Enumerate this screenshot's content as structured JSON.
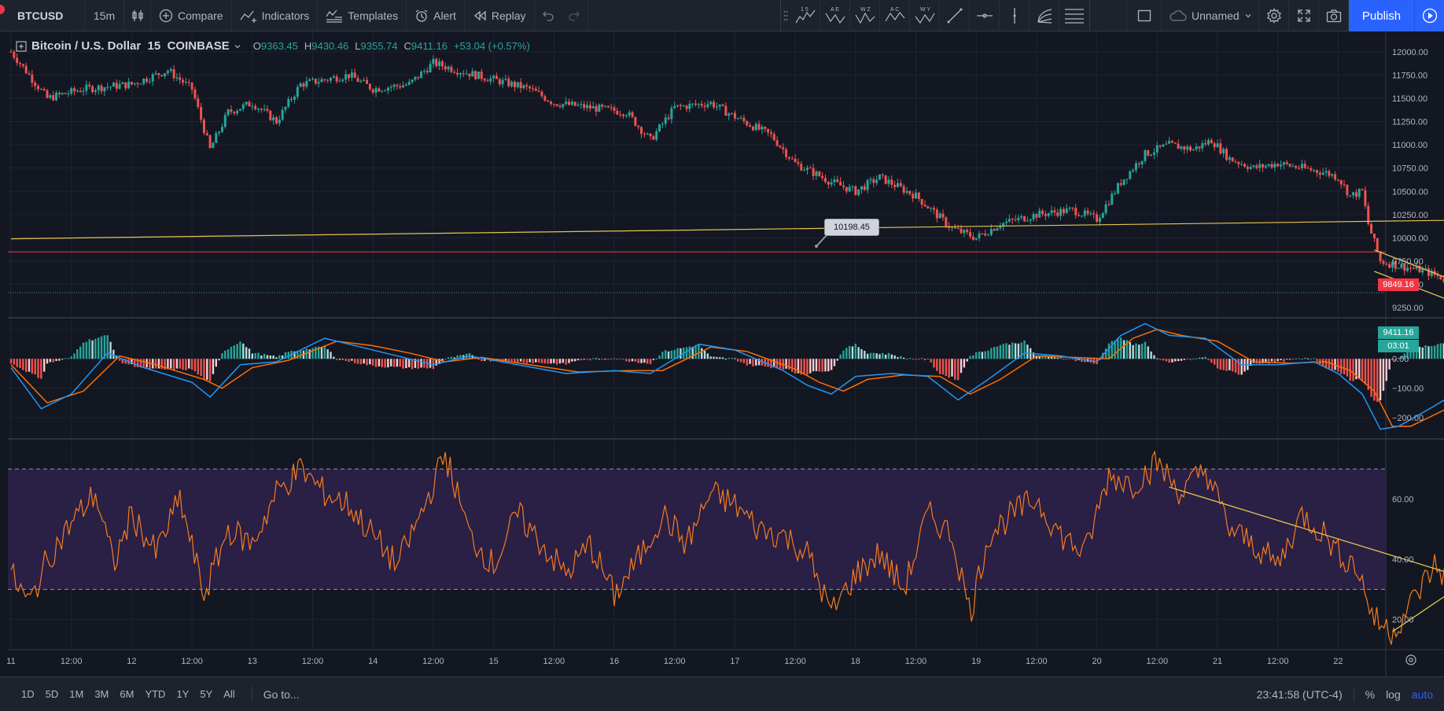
{
  "toolbar": {
    "symbol": "BTCUSD",
    "interval": "15m",
    "compare": "Compare",
    "indicators": "Indicators",
    "templates": "Templates",
    "alert": "Alert",
    "replay": "Replay",
    "layout_name": "Unnamed",
    "publish": "Publish",
    "pattern_tools": [
      {
        "top": "1 5",
        "icon": "pattern-icon"
      },
      {
        "top": "A E",
        "icon": "pattern-icon"
      },
      {
        "top": "W Z",
        "icon": "pattern-icon"
      },
      {
        "top": "A C",
        "icon": "pattern-icon"
      },
      {
        "top": "W Y",
        "icon": "pattern-icon"
      }
    ]
  },
  "legend": {
    "title": "Bitcoin / U.S. Dollar",
    "interval": "15",
    "exchange": "COINBASE",
    "o_label": "O",
    "o": "9363.45",
    "h_label": "H",
    "h": "9430.46",
    "l_label": "L",
    "l": "9355.74",
    "c_label": "C",
    "c": "9411.16",
    "change": "+53.04 (+0.57%)"
  },
  "price_axis": {
    "ticks": [
      "12000.00",
      "11750.00",
      "11500.00",
      "11250.00",
      "11000.00",
      "10750.00",
      "10500.00",
      "10250.00",
      "10000.00",
      "9750.00",
      "9500.00"
    ],
    "red_line_label": "9849.16",
    "last_price_label": "9411.16",
    "countdown": "03:01",
    "hidden_tick": "9250.00"
  },
  "macd_axis": {
    "ticks": [
      "100.00",
      "0.00",
      "−100.00",
      "−200.00"
    ]
  },
  "rsi_axis": {
    "ticks": [
      "60.00",
      "40.00",
      "20.00"
    ]
  },
  "time_axis": {
    "labels": [
      "11",
      "12:00",
      "12",
      "12:00",
      "13",
      "12:00",
      "14",
      "12:00",
      "15",
      "12:00",
      "16",
      "12:00",
      "17",
      "12:00",
      "18",
      "12:00",
      "19",
      "12:00",
      "20",
      "12:00",
      "21",
      "12:00",
      "22"
    ]
  },
  "trendline_tooltip": "10198.45",
  "bottom": {
    "ranges": [
      "1D",
      "5D",
      "1M",
      "3M",
      "6M",
      "YTD",
      "1Y",
      "5Y",
      "All"
    ],
    "goto": "Go to...",
    "clock": "23:41:58 (UTC-4)",
    "percent": "%",
    "log": "log",
    "auto": "auto"
  },
  "colors": {
    "bg": "#131722",
    "up": "#26a69a",
    "down": "#ef5350",
    "trend": "#e5c54f",
    "red_line": "#f23645",
    "macd": "#2196f3",
    "signal": "#ff6d00",
    "rsi": "#f57c1f",
    "rsi_band": "#2a1f45",
    "accent": "#2962ff"
  },
  "chart_data": {
    "type": "candlestick",
    "symbol": "BTCUSD",
    "interval": "15",
    "ylim": [
      9150,
      12150
    ],
    "close_path": [
      [
        0,
        12000
      ],
      [
        0.3,
        11500
      ],
      [
        0.6,
        11600
      ],
      [
        1.0,
        11650
      ],
      [
        1.3,
        11800
      ],
      [
        1.5,
        11600
      ],
      [
        1.65,
        10950
      ],
      [
        1.8,
        11350
      ],
      [
        2.0,
        11450
      ],
      [
        2.2,
        11250
      ],
      [
        2.4,
        11650
      ],
      [
        2.6,
        11700
      ],
      [
        2.8,
        11750
      ],
      [
        3.0,
        11600
      ],
      [
        3.3,
        11650
      ],
      [
        3.5,
        11880
      ],
      [
        3.7,
        11800
      ],
      [
        4.0,
        11700
      ],
      [
        4.3,
        11600
      ],
      [
        4.5,
        11450
      ],
      [
        4.8,
        11400
      ],
      [
        5.1,
        11350
      ],
      [
        5.3,
        11050
      ],
      [
        5.5,
        11400
      ],
      [
        5.8,
        11450
      ],
      [
        6.0,
        11300
      ],
      [
        6.3,
        11100
      ],
      [
        6.5,
        10800
      ],
      [
        6.8,
        10600
      ],
      [
        7.0,
        10500
      ],
      [
        7.2,
        10650
      ],
      [
        7.5,
        10450
      ],
      [
        7.8,
        10100
      ],
      [
        8.0,
        10000
      ],
      [
        8.2,
        10150
      ],
      [
        8.5,
        10250
      ],
      [
        8.8,
        10300
      ],
      [
        9.0,
        10200
      ],
      [
        9.2,
        10600
      ],
      [
        9.4,
        10900
      ],
      [
        9.6,
        11000
      ],
      [
        9.8,
        10950
      ],
      [
        9.95,
        11050
      ],
      [
        10.1,
        10850
      ],
      [
        10.3,
        10750
      ],
      [
        10.5,
        10800
      ],
      [
        10.7,
        10750
      ],
      [
        10.9,
        10700
      ],
      [
        11.0,
        10650
      ],
      [
        11.1,
        10450
      ],
      [
        11.2,
        10500
      ],
      [
        11.25,
        10150
      ],
      [
        11.3,
        9950
      ],
      [
        11.35,
        9750
      ],
      [
        11.5,
        9700
      ],
      [
        11.7,
        9650
      ],
      [
        11.9,
        9550
      ],
      [
        12.0,
        9520
      ],
      [
        12.1,
        9420
      ],
      [
        12.2,
        9411
      ]
    ],
    "trendline": {
      "x": [
        0,
        22.8
      ],
      "y": [
        9990,
        10370
      ]
    },
    "horizontal_level": 9849.16,
    "last_price": 9411.16,
    "channel": {
      "upper": [
        [
          11.3,
          9870
        ],
        [
          12.1,
          9470
        ]
      ],
      "lower": [
        [
          11.3,
          9640
        ],
        [
          12.1,
          9240
        ]
      ]
    },
    "macd": {
      "ylim": [
        -270,
        140
      ],
      "macd_line": [
        [
          0,
          -30
        ],
        [
          0.25,
          -170
        ],
        [
          0.5,
          -120
        ],
        [
          0.8,
          20
        ],
        [
          1.1,
          -30
        ],
        [
          1.5,
          -80
        ],
        [
          1.65,
          -130
        ],
        [
          1.9,
          -20
        ],
        [
          2.2,
          -10
        ],
        [
          2.6,
          70
        ],
        [
          2.9,
          40
        ],
        [
          3.1,
          20
        ],
        [
          3.5,
          -20
        ],
        [
          3.8,
          10
        ],
        [
          4.2,
          -20
        ],
        [
          4.6,
          -50
        ],
        [
          5.0,
          -40
        ],
        [
          5.3,
          -50
        ],
        [
          5.7,
          50
        ],
        [
          6.0,
          30
        ],
        [
          6.4,
          -40
        ],
        [
          6.6,
          -90
        ],
        [
          6.8,
          -120
        ],
        [
          7.0,
          -60
        ],
        [
          7.3,
          -50
        ],
        [
          7.6,
          -60
        ],
        [
          7.85,
          -140
        ],
        [
          8.1,
          -70
        ],
        [
          8.4,
          20
        ],
        [
          8.7,
          10
        ],
        [
          9.0,
          -10
        ],
        [
          9.2,
          80
        ],
        [
          9.4,
          120
        ],
        [
          9.6,
          80
        ],
        [
          9.9,
          70
        ],
        [
          10.2,
          -20
        ],
        [
          10.5,
          -20
        ],
        [
          10.8,
          -10
        ],
        [
          11.0,
          -50
        ],
        [
          11.2,
          -120
        ],
        [
          11.35,
          -240
        ],
        [
          11.5,
          -230
        ],
        [
          11.8,
          -160
        ],
        [
          12.0,
          -110
        ],
        [
          12.2,
          -90
        ]
      ],
      "signal_line": [
        [
          0,
          -20
        ],
        [
          0.3,
          -150
        ],
        [
          0.6,
          -110
        ],
        [
          0.9,
          10
        ],
        [
          1.2,
          -20
        ],
        [
          1.6,
          -70
        ],
        [
          1.75,
          -100
        ],
        [
          2.0,
          -30
        ],
        [
          2.3,
          -5
        ],
        [
          2.7,
          60
        ],
        [
          3.0,
          45
        ],
        [
          3.3,
          20
        ],
        [
          3.6,
          -10
        ],
        [
          3.9,
          5
        ],
        [
          4.3,
          -20
        ],
        [
          4.7,
          -45
        ],
        [
          5.1,
          -40
        ],
        [
          5.4,
          -40
        ],
        [
          5.8,
          40
        ],
        [
          6.1,
          25
        ],
        [
          6.5,
          -35
        ],
        [
          6.7,
          -80
        ],
        [
          6.9,
          -110
        ],
        [
          7.1,
          -70
        ],
        [
          7.4,
          -55
        ],
        [
          7.7,
          -60
        ],
        [
          7.95,
          -120
        ],
        [
          8.2,
          -70
        ],
        [
          8.5,
          10
        ],
        [
          8.8,
          5
        ],
        [
          9.1,
          0
        ],
        [
          9.3,
          70
        ],
        [
          9.5,
          100
        ],
        [
          9.7,
          80
        ],
        [
          10.0,
          60
        ],
        [
          10.3,
          -10
        ],
        [
          10.6,
          -15
        ],
        [
          10.9,
          -10
        ],
        [
          11.1,
          -40
        ],
        [
          11.3,
          -110
        ],
        [
          11.45,
          -230
        ],
        [
          11.6,
          -230
        ],
        [
          11.9,
          -170
        ],
        [
          12.1,
          -120
        ],
        [
          12.2,
          -100
        ]
      ]
    },
    "rsi": {
      "ylim": [
        10,
        80
      ],
      "overbought": 70,
      "oversold": 30,
      "series": [
        [
          0,
          35
        ],
        [
          0.15,
          25
        ],
        [
          0.3,
          40
        ],
        [
          0.5,
          52
        ],
        [
          0.7,
          62
        ],
        [
          0.85,
          38
        ],
        [
          1.0,
          55
        ],
        [
          1.2,
          42
        ],
        [
          1.4,
          60
        ],
        [
          1.6,
          28
        ],
        [
          1.8,
          50
        ],
        [
          2.0,
          45
        ],
        [
          2.2,
          62
        ],
        [
          2.4,
          70
        ],
        [
          2.6,
          62
        ],
        [
          2.8,
          58
        ],
        [
          3.0,
          48
        ],
        [
          3.2,
          38
        ],
        [
          3.4,
          55
        ],
        [
          3.6,
          75
        ],
        [
          3.8,
          48
        ],
        [
          4.0,
          38
        ],
        [
          4.2,
          55
        ],
        [
          4.4,
          45
        ],
        [
          4.6,
          35
        ],
        [
          4.8,
          45
        ],
        [
          5.0,
          28
        ],
        [
          5.2,
          40
        ],
        [
          5.4,
          55
        ],
        [
          5.6,
          45
        ],
        [
          5.8,
          62
        ],
        [
          6.0,
          58
        ],
        [
          6.2,
          50
        ],
        [
          6.4,
          48
        ],
        [
          6.6,
          42
        ],
        [
          6.8,
          22
        ],
        [
          7.0,
          35
        ],
        [
          7.2,
          42
        ],
        [
          7.4,
          30
        ],
        [
          7.6,
          55
        ],
        [
          7.8,
          48
        ],
        [
          7.95,
          22
        ],
        [
          8.1,
          48
        ],
        [
          8.3,
          55
        ],
        [
          8.5,
          60
        ],
        [
          8.7,
          48
        ],
        [
          8.9,
          42
        ],
        [
          9.1,
          68
        ],
        [
          9.3,
          65
        ],
        [
          9.5,
          72
        ],
        [
          9.7,
          62
        ],
        [
          9.9,
          70
        ],
        [
          10.1,
          50
        ],
        [
          10.3,
          45
        ],
        [
          10.5,
          38
        ],
        [
          10.7,
          55
        ],
        [
          10.9,
          48
        ],
        [
          11.0,
          42
        ],
        [
          11.15,
          38
        ],
        [
          11.3,
          20
        ],
        [
          11.45,
          16
        ],
        [
          11.6,
          25
        ],
        [
          11.8,
          38
        ],
        [
          12.0,
          30
        ],
        [
          12.1,
          40
        ],
        [
          12.2,
          42
        ]
      ],
      "trend_upper": [
        [
          9.6,
          64
        ],
        [
          12.2,
          32
        ]
      ],
      "trend_lower": [
        [
          11.45,
          16
        ],
        [
          12.3,
          39
        ]
      ]
    }
  }
}
